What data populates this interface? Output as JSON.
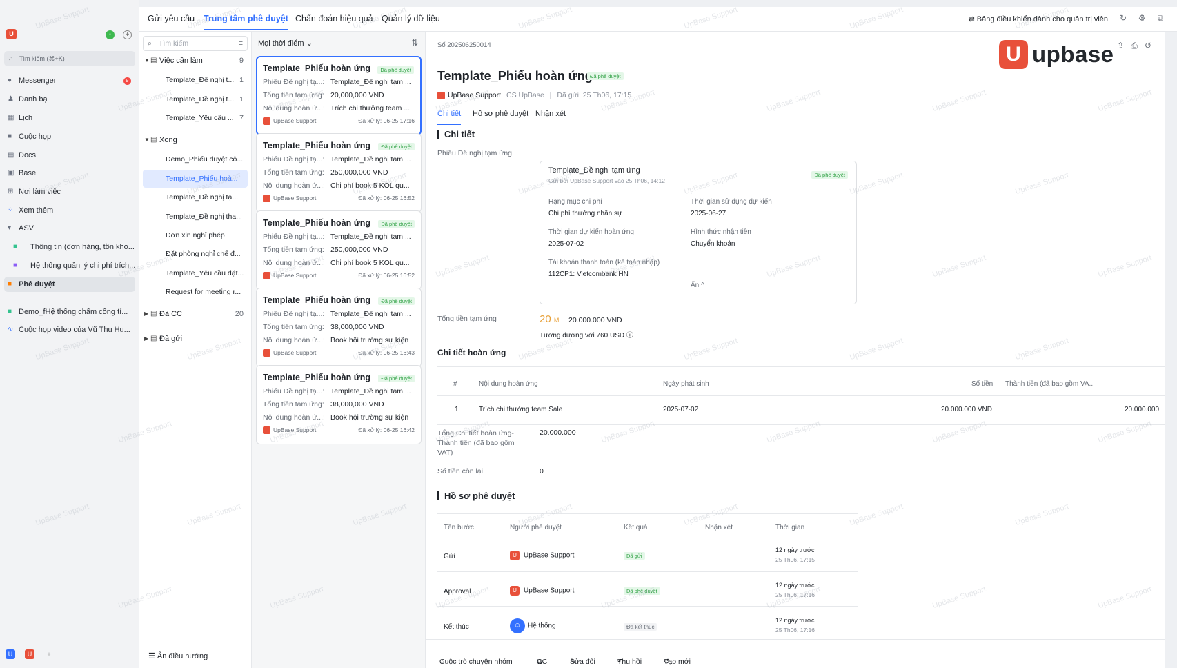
{
  "leftnav": {
    "logo_text": "U",
    "search": "Tìm kiếm (⌘+K)",
    "items": [
      {
        "label": "Messenger",
        "badge": "9"
      },
      {
        "label": "Danh bạ"
      },
      {
        "label": "Lịch"
      },
      {
        "label": "Cuộc họp"
      },
      {
        "label": "Docs"
      },
      {
        "label": "Base"
      },
      {
        "label": "Nơi làm việc"
      },
      {
        "label": "Xem thêm"
      },
      {
        "label": "ASV"
      },
      {
        "label": "Thông tin (đơn hàng, tồn kho..."
      },
      {
        "label": "Hệ thống quản lý chi phí trích..."
      },
      {
        "label": "Phê duyệt"
      },
      {
        "label": "Demo_fHệ thống chấm công tí..."
      },
      {
        "label": "Cuộc họp video của Vũ Thu Hu..."
      }
    ]
  },
  "topbar": {
    "tabs": [
      "Gửi yêu cầu",
      "Trung tâm phê duyệt",
      "Chẩn đoán hiệu quả",
      "Quản lý dữ liệu"
    ],
    "admin": "Bảng điều khiển dành cho quản trị viên"
  },
  "apnav": {
    "search": "Tìm kiếm",
    "groups": [
      {
        "label": "Việc cần làm",
        "count": "9"
      },
      {
        "label": "Xong"
      },
      {
        "label": "Đã CC",
        "count": "20"
      },
      {
        "label": "Đã gửi"
      }
    ],
    "todo": [
      {
        "label": "Template_Đề nghị t...",
        "count": "1"
      },
      {
        "label": "Template_Đề nghị t...",
        "count": "1"
      },
      {
        "label": "Template_Yêu cầu ...",
        "count": "7"
      }
    ],
    "done": [
      "Demo_Phiếu duyệt cô...",
      "Template_Phiếu hoà...",
      "Template_Đề nghị tạ...",
      "Template_Đề nghị tha...",
      "Đơn xin nghỉ phép",
      "Đặt phòng nghỉ chế đ...",
      "Template_Yêu cầu đặt...",
      "Request for meeting r..."
    ],
    "footer": "Ẩn điều hướng"
  },
  "list": {
    "filter": "Mọi thời điểm",
    "cards": [
      {
        "title": "Template_Phiếu hoàn ứng",
        "tag": "Đã phê duyệt",
        "k1": "Phiếu Đề nghị tạ...:",
        "v1": "Template_Đề nghị tạm ...",
        "k2": "Tổng tiền tạm ứng:",
        "v2": "20,000,000 VND",
        "k3": "Nội dung hoàn ứ...:",
        "v3": "Trích chi thưởng team ...",
        "user": "UpBase Support",
        "date": "Đã xử lý: 06-25 17:16"
      },
      {
        "title": "Template_Phiếu hoàn ứng",
        "tag": "Đã phê duyệt",
        "k1": "Phiếu Đề nghị tạ...:",
        "v1": "Template_Đề nghị tạm ...",
        "k2": "Tổng tiền tạm ứng:",
        "v2": "250,000,000 VND",
        "k3": "Nội dung hoàn ứ...:",
        "v3": "Chi phí book 5 KOL qu...",
        "user": "UpBase Support",
        "date": "Đã xử lý: 06-25 16:52"
      },
      {
        "title": "Template_Phiếu hoàn ứng",
        "tag": "Đã phê duyệt",
        "k1": "Phiếu Đề nghị tạ...:",
        "v1": "Template_Đề nghị tạm ...",
        "k2": "Tổng tiền tạm ứng:",
        "v2": "250,000,000 VND",
        "k3": "Nội dung hoàn ứ...:",
        "v3": "Chi phí book 5 KOL qu...",
        "user": "UpBase Support",
        "date": "Đã xử lý: 06-25 16:52"
      },
      {
        "title": "Template_Phiếu hoàn ứng",
        "tag": "Đã phê duyệt",
        "k1": "Phiếu Đề nghị tạ...:",
        "v1": "Template_Đề nghị tạm ...",
        "k2": "Tổng tiền tạm ứng:",
        "v2": "38,000,000 VND",
        "k3": "Nội dung hoàn ứ...:",
        "v3": "Book hội trường sự kiện",
        "user": "UpBase Support",
        "date": "Đã xử lý: 06-25 16:43"
      },
      {
        "title": "Template_Phiếu hoàn ứng",
        "tag": "Đã phê duyệt",
        "k1": "Phiếu Đề nghị tạ...:",
        "v1": "Template_Đề nghị tạm ...",
        "k2": "Tổng tiền tạm ứng:",
        "v2": "38,000,000 VND",
        "k3": "Nội dung hoàn ứ...:",
        "v3": "Book hội trường sự kiện",
        "user": "UpBase Support",
        "date": "Đã xử lý: 06-25 16:42"
      }
    ]
  },
  "detail": {
    "doc_no": "Số 202506250014",
    "brand": "upbase",
    "title": "Template_Phiếu hoàn ứng",
    "status": "Đã phê duyệt",
    "submitter": "UpBase Support",
    "dept": "CS UpBase",
    "sent": "Đã gửi: 25 Th06, 17:15",
    "tabs": [
      "Chi tiết",
      "Hồ sơ phê duyệt",
      "Nhận xét"
    ],
    "sec_detail": "Chi tiết",
    "ref_label": "Phiếu Đề nghị tạm ứng",
    "ref": {
      "title": "Template_Đề nghị tạm ứng",
      "sub": "Gửi bởi UpBase Support vào 25 Th06, 14:12",
      "tag": "Đã phê duyệt",
      "k1": "Hạng mục chi phí",
      "v1": "Chi phí thưởng nhân sự",
      "k2": "Thời gian sử dụng dự kiến",
      "v2": "2025-06-27",
      "k3": "Thời gian dự kiến hoàn ứng",
      "v3": "2025-07-02",
      "k4": "Hình thức nhận tiền",
      "v4": "Chuyển khoản",
      "k5": "Tài khoản thanh toán (kế toán nhập)",
      "v5": "112CP1: Vietcombank HN",
      "hide": "Ẩn ^"
    },
    "amount_label": "Tổng tiền tạm ứng",
    "amount_big": "20",
    "amount_unit": "M",
    "amount_full": "20.000.000 VND",
    "amount_usd": "Tương đương với 760 USD ⓘ",
    "sec_refund": "Chi tiết hoàn ứng",
    "refund_headers": [
      "#",
      "Nội dung hoàn ứng",
      "Ngày phát sinh",
      "Số tiền",
      "Thành tiền (đã bao gồm VA..."
    ],
    "refund_row": [
      "1",
      "Trích chi thưởng team Sale",
      "2025-07-02",
      "20.000.000 VND",
      "20.000.000"
    ],
    "total_label": "Tổng Chi tiết hoàn ứng-Thành tiền (đã bao gồm VAT)",
    "total_val": "20.000.000",
    "remain_label": "Số tiền còn lại",
    "remain_val": "0",
    "sec_history": "Hồ sơ phê duyệt",
    "hist_headers": [
      "Tên bước",
      "Người phê duyệt",
      "Kết quả",
      "Nhận xét",
      "Thời gian"
    ],
    "hist_rows": [
      {
        "step": "Gửi",
        "who": "UpBase Support",
        "result": "Đã gửi",
        "t1": "12 ngày trước",
        "t2": "25 Th06, 17:15"
      },
      {
        "step": "Approval",
        "who": "UpBase Support",
        "result": "Đã phê duyệt",
        "t1": "12 ngày trước",
        "t2": "25 Th06, 17:16"
      },
      {
        "step": "Kết thúc",
        "who": "Hệ thống",
        "result": "Đã kết thúc",
        "t1": "12 ngày trước",
        "t2": "25 Th06, 17:16"
      }
    ],
    "actions": [
      "Cuộc trò chuyện nhóm",
      "CC",
      "Sửa đổi",
      "Thu hồi",
      "Tạo mới"
    ]
  },
  "watermark": "UpBase Support"
}
